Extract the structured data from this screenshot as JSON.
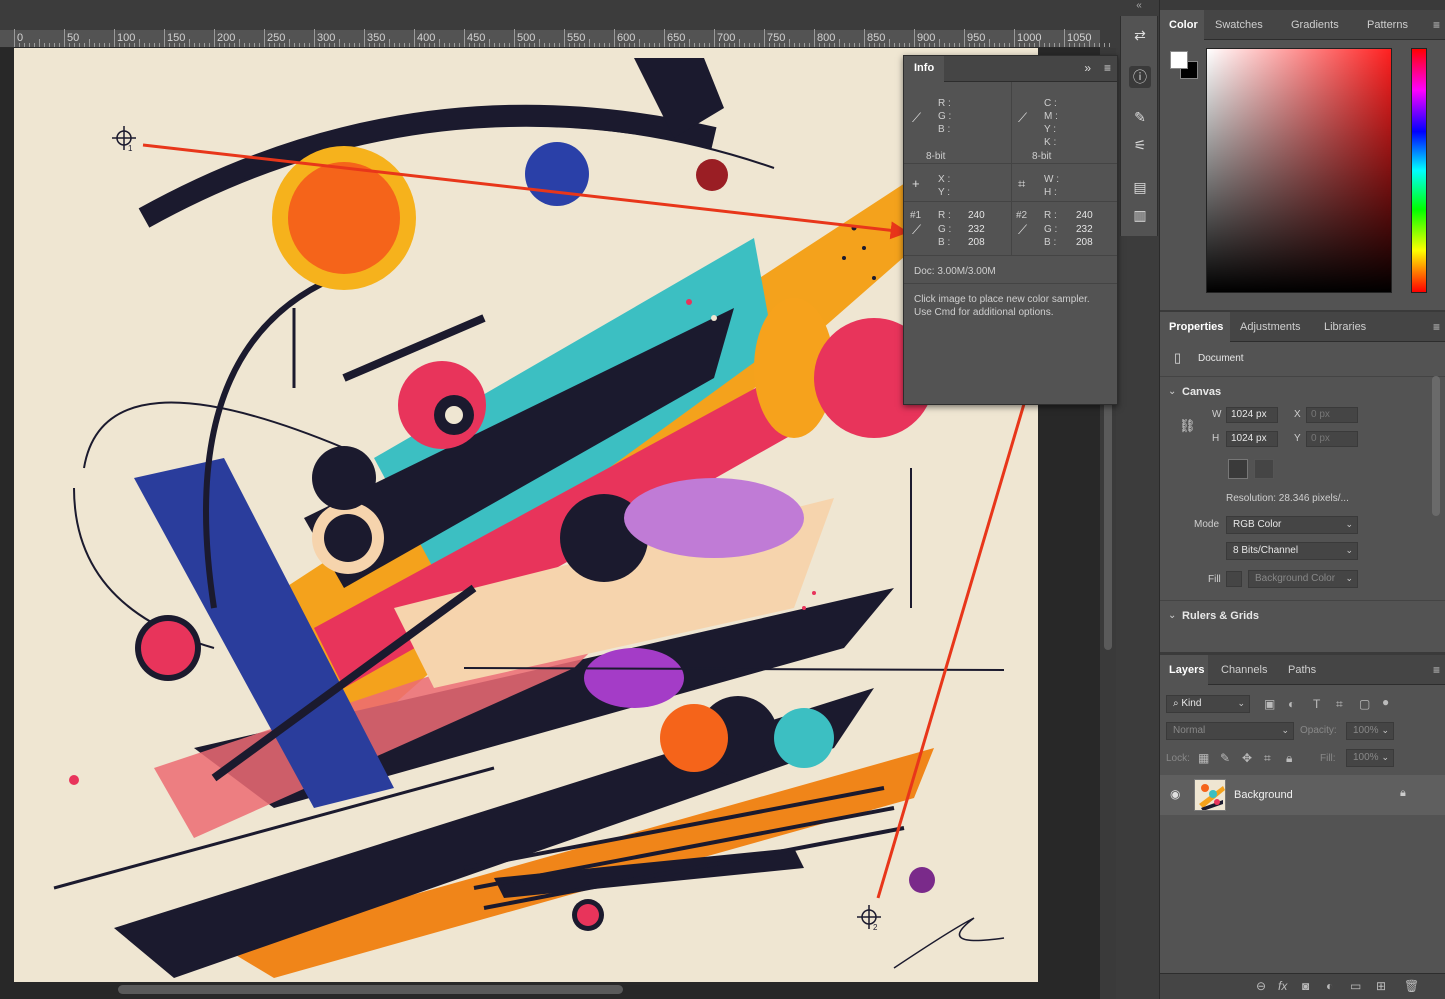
{
  "ruler": {
    "labels": [
      "0",
      "50",
      "100",
      "150",
      "200",
      "250",
      "300",
      "350",
      "400",
      "450",
      "500",
      "550",
      "600",
      "650",
      "700",
      "750",
      "800",
      "850",
      "900",
      "950",
      "1000",
      "1050"
    ]
  },
  "samplers": {
    "s1_label": "1",
    "s2_label": "2"
  },
  "info": {
    "tab": "Info",
    "rgb_labels": [
      "R :",
      "G :",
      "B :"
    ],
    "cmyk_labels": [
      "C :",
      "M :",
      "Y :",
      "K :"
    ],
    "bitdepth_left": "8-bit",
    "bitdepth_right": "8-bit",
    "xy_labels": [
      "X :",
      "Y :"
    ],
    "wh_labels": [
      "W :",
      "H :"
    ],
    "sampler1": {
      "id": "#1",
      "labels": [
        "R :",
        "G :",
        "B :"
      ],
      "values": [
        "240",
        "232",
        "208"
      ]
    },
    "sampler2": {
      "id": "#2",
      "labels": [
        "R :",
        "G :",
        "B :"
      ],
      "values": [
        "240",
        "232",
        "208"
      ]
    },
    "doc": "Doc: 3.00M/3.00M",
    "hint_line1": "Click image to place new color sampler.",
    "hint_line2": "Use Cmd for additional options."
  },
  "color_panel": {
    "tabs": [
      "Color",
      "Swatches",
      "Gradients",
      "Patterns"
    ]
  },
  "properties": {
    "tabs": [
      "Properties",
      "Adjustments",
      "Libraries"
    ],
    "document_label": "Document",
    "canvas_heading": "Canvas",
    "w_label": "W",
    "w_value": "1024 px",
    "h_label": "H",
    "h_value": "1024 px",
    "x_label": "X",
    "x_value": "0 px",
    "y_label": "Y",
    "y_value": "0 px",
    "resolution": "Resolution: 28.346 pixels/...",
    "mode_label": "Mode",
    "mode_value": "RGB Color",
    "bits_value": "8 Bits/Channel",
    "fill_label": "Fill",
    "fill_value": "Background Color",
    "rulers_heading": "Rulers & Grids"
  },
  "layers": {
    "tabs": [
      "Layers",
      "Channels",
      "Paths"
    ],
    "kind_placeholder": "Kind",
    "blend_mode": "Normal",
    "opacity_label": "Opacity:",
    "opacity_value": "100%",
    "lock_label": "Lock:",
    "fill_label": "Fill:",
    "fill_value": "100%",
    "layer_name": "Background"
  },
  "colors": {
    "accent_arrow": "#e8361a",
    "panel_bg": "#535353",
    "canvas_bg": "#efe6d2"
  }
}
